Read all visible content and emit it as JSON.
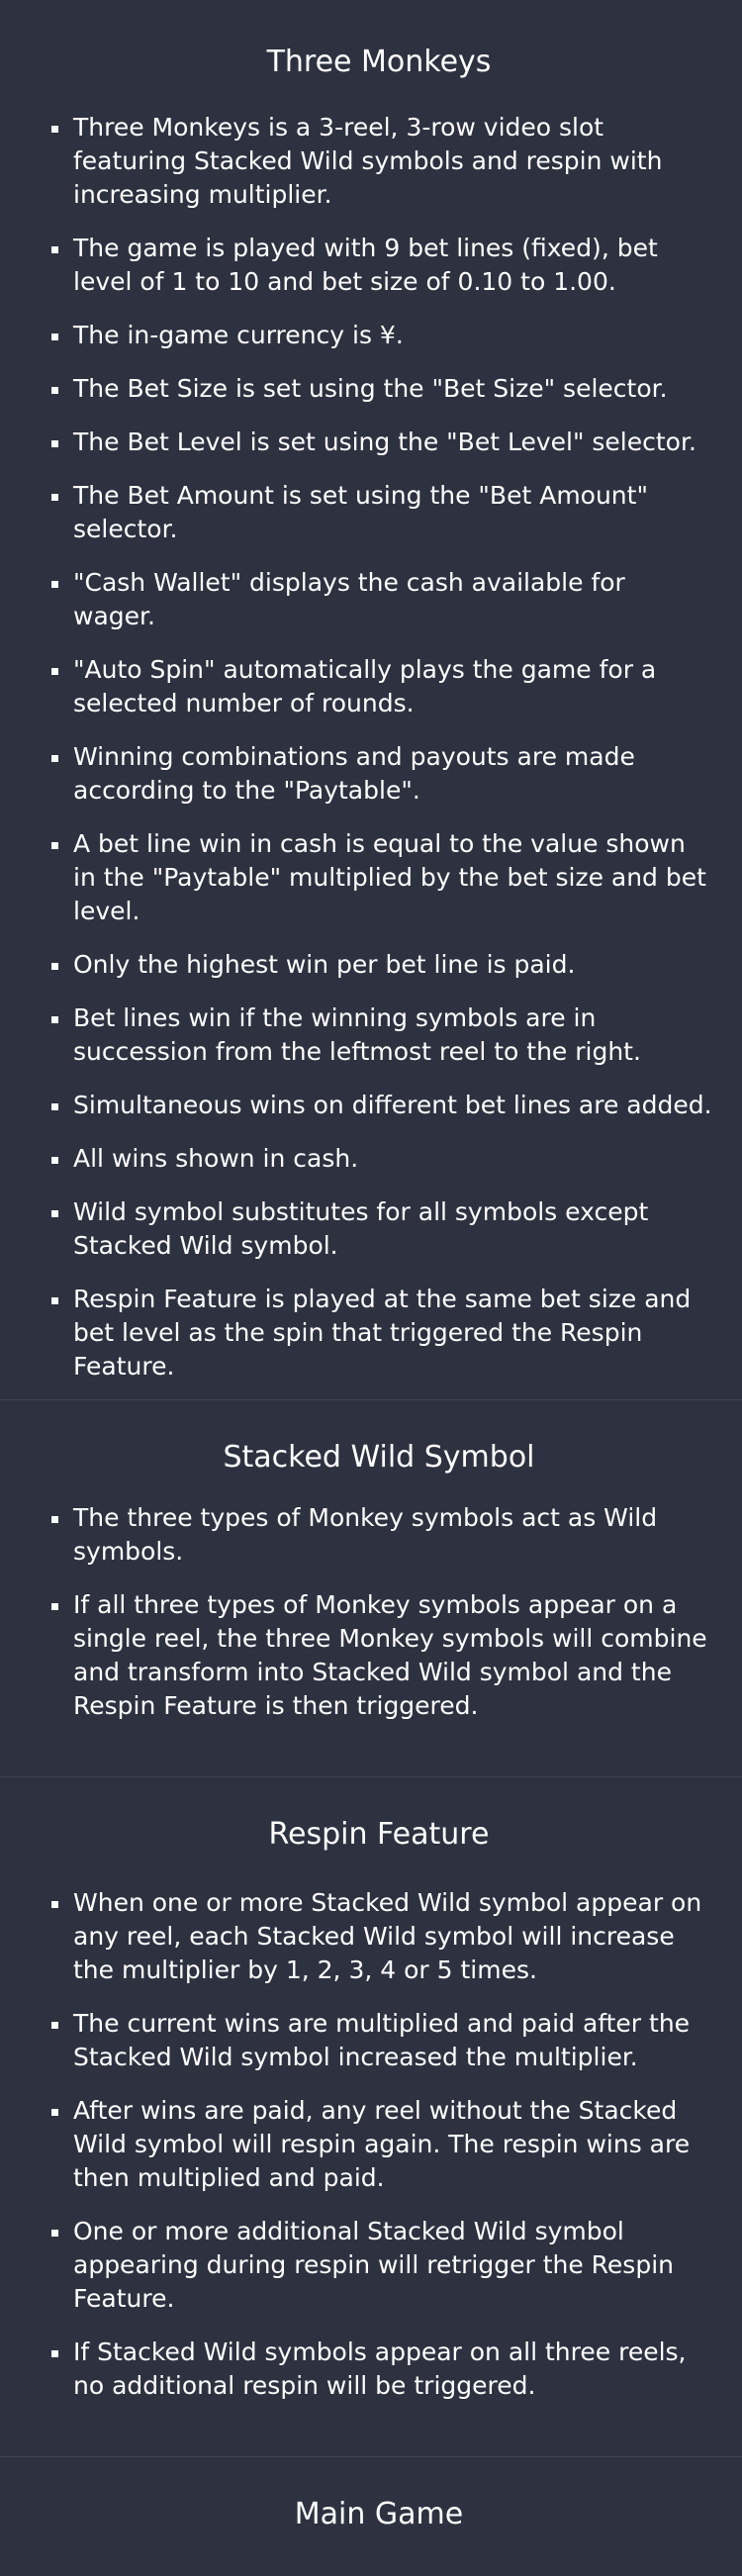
{
  "sections": [
    {
      "title": "Three Monkeys",
      "items": [
        "Three Monkeys is a 3-reel, 3-row video slot featuring Stacked Wild symbols and respin with increasing multiplier.",
        "The game is played with 9 bet lines (fixed), bet level of 1 to 10 and bet size of 0.10 to 1.00.",
        "The in-game currency is ¥.",
        "The Bet Size is set using the \"Bet Size\" selector.",
        "The Bet Level is set using the \"Bet Level\" selector.",
        "The Bet Amount is set using the \"Bet Amount\" selector.",
        "\"Cash Wallet\" displays the cash available for wager.",
        "\"Auto Spin\" automatically plays the game for a selected number of rounds.",
        "Winning combinations and payouts are made according to the \"Paytable\".",
        "A bet line win in cash is equal to the value shown in the \"Paytable\" multiplied by the bet size and bet level.",
        "Only the highest win per bet line is paid.",
        "Bet lines win if the winning symbols are in succession from the leftmost reel to the right.",
        "Simultaneous wins on different bet lines are added.",
        "All wins shown in cash.",
        "Wild symbol substitutes for all symbols except Stacked Wild symbol.",
        "Respin Feature is played at the same bet size and bet level as the spin that triggered the Respin Feature."
      ]
    },
    {
      "title": "Stacked Wild Symbol",
      "items": [
        "The three types of Monkey symbols act as Wild symbols.",
        "If all three types of Monkey symbols appear on a single reel, the three Monkey symbols will combine and transform into Stacked Wild symbol and the Respin Feature is then triggered."
      ]
    },
    {
      "title": "Respin Feature",
      "items": [
        "When one or more Stacked Wild symbol appear on any reel, each Stacked Wild symbol will increase the multiplier by 1, 2, 3, 4 or 5 times.",
        "The current wins are multiplied and paid after the Stacked Wild symbol increased the multiplier.",
        "After wins are paid, any reel without the Stacked Wild symbol will respin again. The respin wins are then multiplied and paid.",
        "One or more additional Stacked Wild symbol appearing during respin will retrigger the Respin Feature.",
        "If Stacked Wild symbols appear on all three reels, no additional respin will be triggered."
      ]
    },
    {
      "title": "Main Game",
      "items": []
    }
  ],
  "colors": {
    "background": "#2e3140",
    "divider": "#3f4252",
    "text": "#ffffff"
  }
}
